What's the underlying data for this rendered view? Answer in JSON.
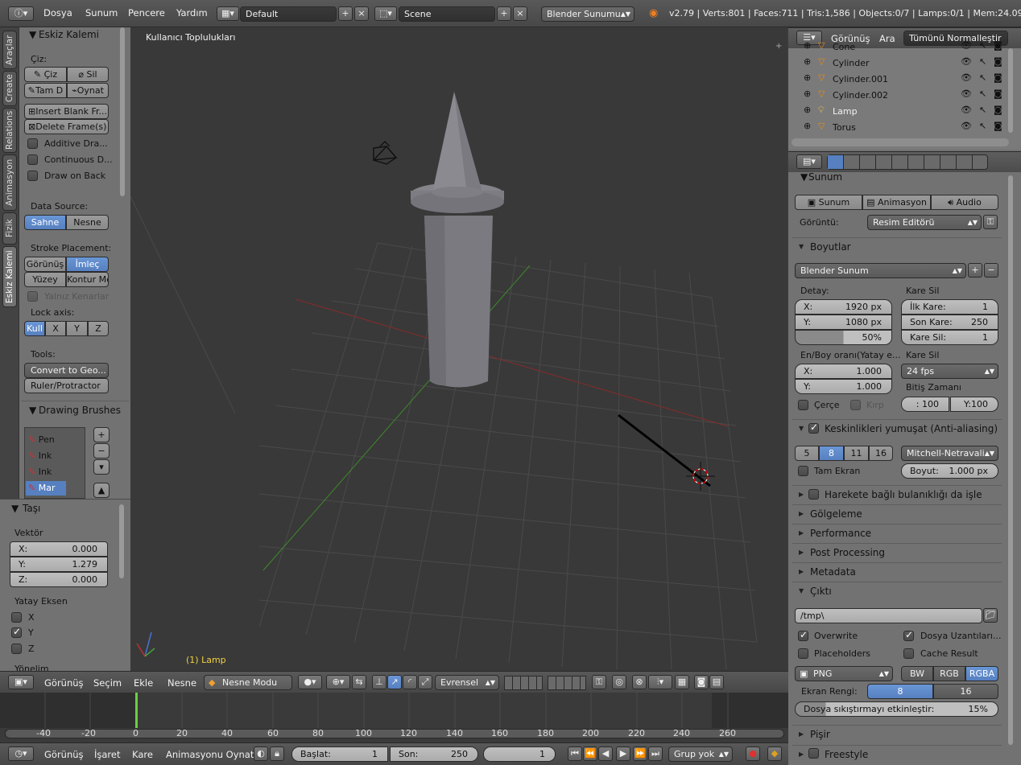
{
  "topbar": {
    "menus": [
      "Dosya",
      "Sunum",
      "Pencere",
      "Yardım"
    ],
    "layout": "Default",
    "scene": "Scene",
    "engine": "Blender Sunumu",
    "stats": "v2.79 | Verts:801 | Faces:711 | Tris:1,586 | Objects:0/7 | Lamps:0/1 | Mem:24.09M |"
  },
  "vtabs": [
    "Araçlar",
    "Create",
    "Relations",
    "Animasyon",
    "Fizik",
    "Eskiz Kalemi"
  ],
  "gp_panel": {
    "title": "Eskiz Kalemi",
    "draw_label": "Çiz:",
    "draw": "Çiz",
    "erase": "Sil",
    "line": "Tam D",
    "poly": "Oynat",
    "insert_blank": "Insert Blank Fr...",
    "delete_frame": "Delete Frame(s)",
    "additive": "Additive Dra...",
    "continuous": "Continuous D...",
    "draw_back": "Draw on Back",
    "data_source_label": "Data Source:",
    "src_scene": "Sahne",
    "src_object": "Nesne",
    "stroke_label": "Stroke Placement:",
    "sp_view": "Görünüş",
    "sp_cursor": "İmleç",
    "sp_surface": "Yüzey",
    "sp_stroke": "Kontur Me",
    "only_edges": "Yalnız Kenarlar",
    "lock_label": "Lock axis:",
    "lock": [
      "Kull",
      "X",
      "Y",
      "Z"
    ],
    "tools_label": "Tools:",
    "convert": "Convert to Geo...",
    "ruler": "Ruler/Protractor",
    "brushes_title": "Drawing Brushes",
    "brushes": [
      "Pen",
      "Ink",
      "Ink",
      "Mar"
    ]
  },
  "move_panel": {
    "title": "Taşı",
    "vector_label": "Vektör",
    "x_label": "X:",
    "x": "0.000",
    "y_label": "Y:",
    "y": "1.279",
    "z_label": "Z:",
    "z": "0.000",
    "axis_label": "Yatay Eksen",
    "ax": [
      "X",
      "Y",
      "Z"
    ],
    "orient": "Yönelim"
  },
  "viewport": {
    "title": "Kullanıcı Toplulukları",
    "active": "(1) Lamp"
  },
  "view_header": {
    "view": "Görünüş",
    "select": "Seçim",
    "add": "Ekle",
    "object": "Nesne",
    "mode": "Nesne Modu",
    "orientation": "Evrensel"
  },
  "timeline": {
    "ticks": [
      "-40",
      "-20",
      "0",
      "20",
      "40",
      "60",
      "80",
      "100",
      "120",
      "140",
      "160",
      "180",
      "200",
      "220",
      "240",
      "260"
    ]
  },
  "bottombar": {
    "view": "Görünüş",
    "marker": "İşaret",
    "frame": "Kare",
    "play": "Animasyonu Oynat",
    "start_label": "Başlat:",
    "start": "1",
    "end_label": "Son:",
    "end": "250",
    "current": "1",
    "group": "Grup yok"
  },
  "outliner": {
    "view": "Görünüş",
    "search": "Ara",
    "filter": "Tümünü Normalleştir",
    "items": [
      "Cone",
      "Cylinder",
      "Cylinder.001",
      "Cylinder.002",
      "Lamp",
      "Torus"
    ]
  },
  "properties": {
    "render_sec": "Sunum",
    "render_btn": "Sunum",
    "anim_btn": "Animasyon",
    "audio_btn": "Audio",
    "display_label": "Görüntü:",
    "display": "Resim Editörü",
    "dims_sec": "Boyutlar",
    "preset": "Blender Sunum",
    "res_label": "Detay:",
    "res_x_label": "X:",
    "res_x": "1920 px",
    "res_y_label": "Y:",
    "res_y": "1080 px",
    "res_pct": "50%",
    "frame_range_label": "Kare Sil",
    "start_label": "İlk Kare:",
    "start": "1",
    "end_label": "Son Kare:",
    "end": "250",
    "step_label": "Kare Sil:",
    "step": "1",
    "aspect_label": "En/Boy oranı(Yatay e...",
    "ax_label": "X:",
    "ax": "1.000",
    "ay_label": "Y:",
    "ay": "1.000",
    "rate_label": "Kare Sil",
    "fps": "24 fps",
    "time_label": "Bitiş Zamanı",
    "time_old": ": 100",
    "time_new": "Y:100",
    "border": "Çerçe",
    "crop": "Kırp",
    "aa_sec": "Keskinlikleri yumuşat (Anti-aliasing)",
    "aa_samples": [
      "5",
      "8",
      "11",
      "16"
    ],
    "aa_filter": "Mitchell-Netravali",
    "full_sample": "Tam Ekran",
    "size_label": "Boyut:",
    "size": "1.000 px",
    "mblur_sec": "Harekete bağlı bulanıklığı da işle",
    "shading_sec": "Gölgeleme",
    "perf_sec": "Performance",
    "post_sec": "Post Processing",
    "meta_sec": "Metadata",
    "output_sec": "Çıktı",
    "path": "/tmp\\",
    "overwrite": "Overwrite",
    "extensions": "Dosya Uzantıları...",
    "placeholders": "Placeholders",
    "cache": "Cache Result",
    "format": "PNG",
    "bw": "BW",
    "rgb": "RGB",
    "rgba": "RGBA",
    "depth_label": "Ekran Rengi:",
    "depth8": "8",
    "depth16": "16",
    "compression_label": "Dosya sıkıştırmayı etkinleştir:",
    "compression": "15%",
    "bake_sec": "Pişir",
    "freestyle_sec": "Freestyle"
  }
}
